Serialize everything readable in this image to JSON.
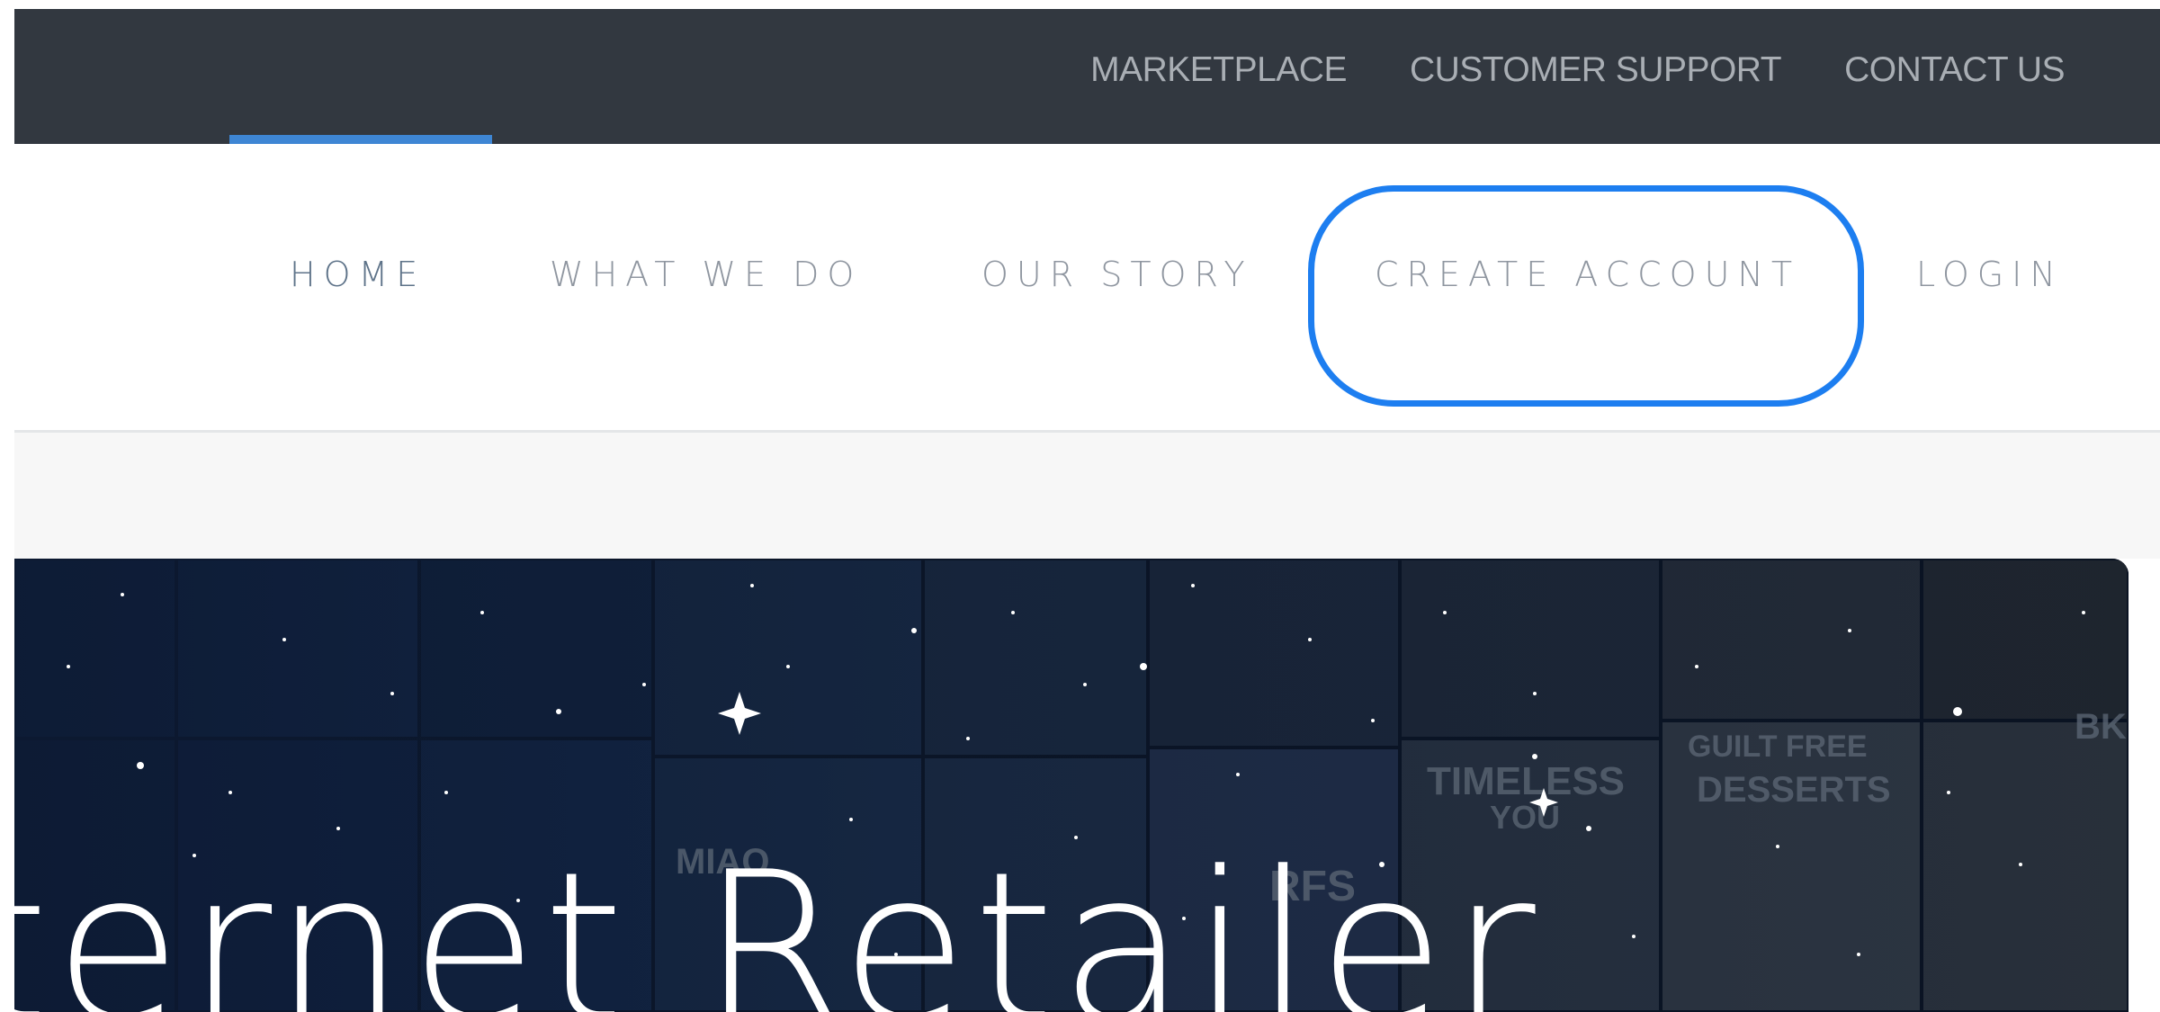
{
  "utility_nav": {
    "items": [
      {
        "label": "MARKETPLACE"
      },
      {
        "label": "CUSTOMER SUPPORT"
      },
      {
        "label": "CONTACT US"
      }
    ]
  },
  "main_nav": {
    "items": [
      {
        "label": "HOME"
      },
      {
        "label": "WHAT WE DO"
      },
      {
        "label": "OUR STORY"
      },
      {
        "label": "CREATE ACCOUNT"
      },
      {
        "label": "LOGIN"
      }
    ]
  },
  "hero": {
    "title": "ternet Retailer",
    "tile_texts": {
      "timeless": "TIMELESS",
      "you": "YOU",
      "guilt_free": "GUILT FREE",
      "desserts": "DESSERTS",
      "rfs": "RFS",
      "miao": "MIAO",
      "bk": "BK"
    }
  },
  "colors": {
    "topbar": "#323840",
    "accent": "#3e86d4",
    "highlight": "#1d7ef0",
    "nav_text": "#8f96a0",
    "nav_active": "#5e7389"
  }
}
